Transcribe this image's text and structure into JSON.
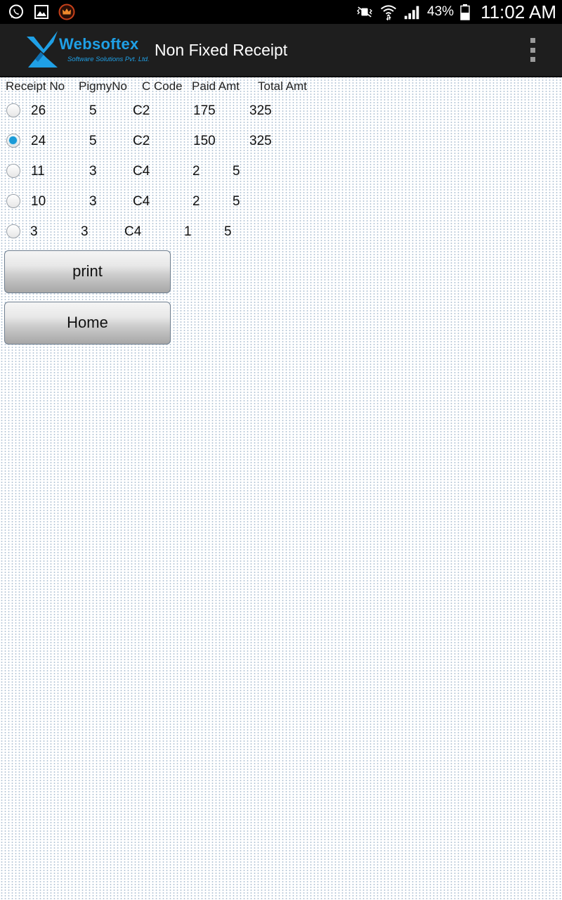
{
  "status_bar": {
    "left_icons": [
      "whatsapp-icon",
      "gallery-icon",
      "crown-app-icon"
    ],
    "battery_percent": "43%",
    "time": "11:02 AM"
  },
  "action_bar": {
    "logo": {
      "brand": "Websoftex",
      "tagline": "Software Solutions Pvt. Ltd."
    },
    "title": "Non Fixed Receipt"
  },
  "table": {
    "headers": [
      "Receipt No",
      "PigmyNo",
      "C Code",
      "Paid Amt",
      "Total Amt"
    ],
    "rows": [
      {
        "receipt_no": "26",
        "pigmy_no": "5",
        "c_code": "C2",
        "paid_amt": "175",
        "total_amt": "325",
        "selected": false
      },
      {
        "receipt_no": "24",
        "pigmy_no": "5",
        "c_code": "C2",
        "paid_amt": "150",
        "total_amt": "325",
        "selected": true
      },
      {
        "receipt_no": "11",
        "pigmy_no": "3",
        "c_code": "C4",
        "paid_amt": "2",
        "total_amt": "5",
        "selected": false
      },
      {
        "receipt_no": "10",
        "pigmy_no": "3",
        "c_code": "C4",
        "paid_amt": "2",
        "total_amt": "5",
        "selected": false
      },
      {
        "receipt_no": "3",
        "pigmy_no": "3",
        "c_code": "C4",
        "paid_amt": "1",
        "total_amt": "5",
        "selected": false
      }
    ]
  },
  "buttons": {
    "print_label": "print",
    "home_label": "Home"
  },
  "colors": {
    "accent": "#1a9bd8",
    "brand": "#1fa0e6",
    "action_bar_bg": "#1e1e1e"
  }
}
